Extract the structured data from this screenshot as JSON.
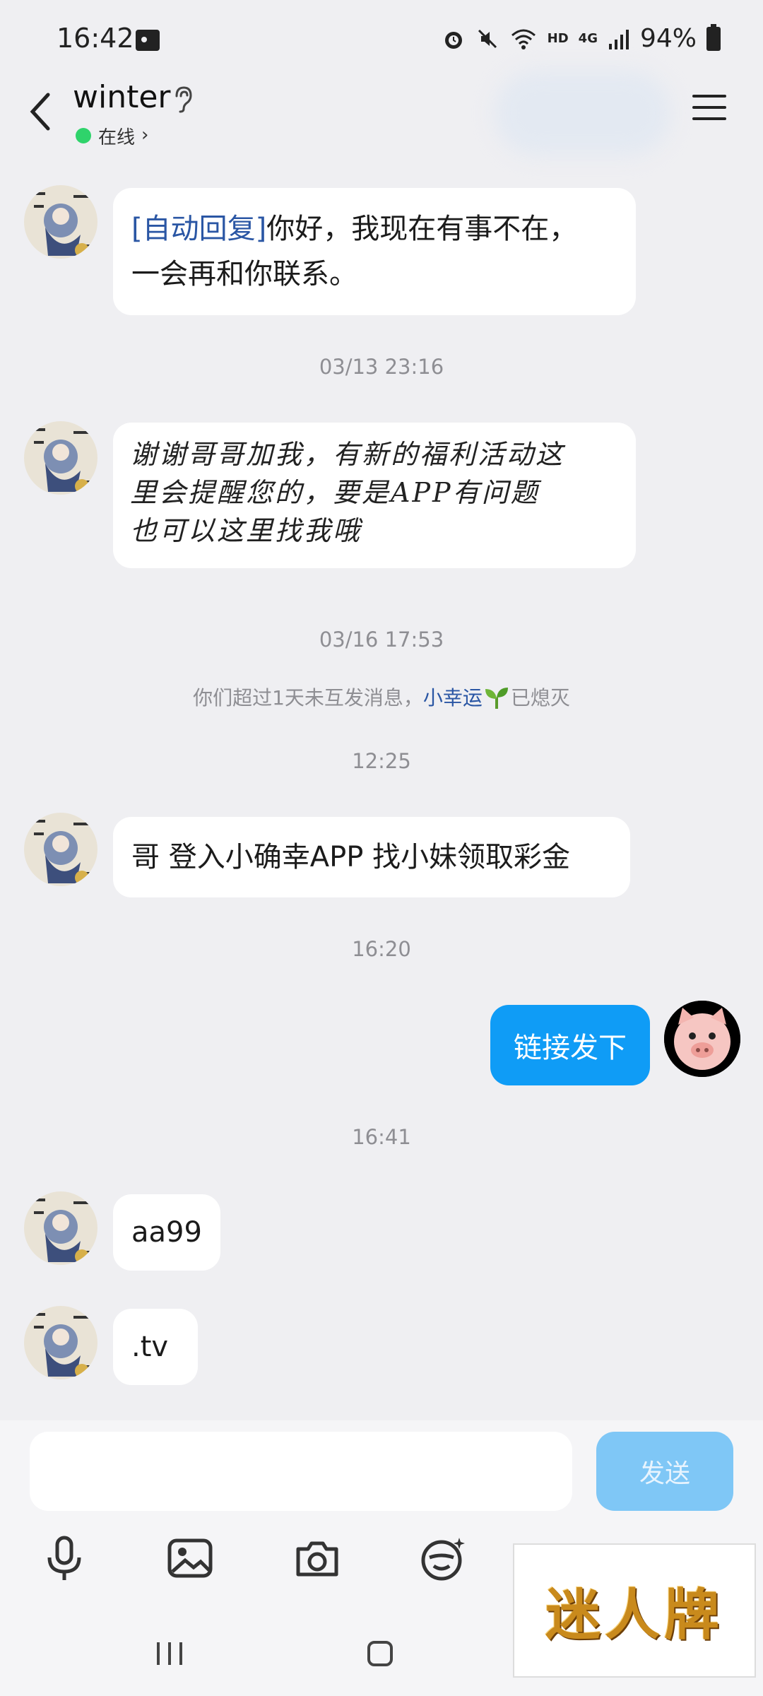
{
  "status_bar": {
    "time": "16:42",
    "hd_label": "HD",
    "network_label": "4G",
    "battery": "94%"
  },
  "header": {
    "contact_name": "winter",
    "status": "在线"
  },
  "messages": {
    "m1_tag": "[自动回复]",
    "m1_text_a": "你好，我现在有事不在，",
    "m1_text_b": "一会再和你联系。",
    "ts1": "03/13 23:16",
    "m2_line1": "谢谢哥哥加我，有新的福利活动这",
    "m2_line2": "里会提醒您的，要是APP有问题",
    "m2_line3": "也可以这里找我哦",
    "ts2": "03/16 17:53",
    "sys_prefix": "你们超过1天未互发消息，",
    "sys_link": "小幸运",
    "sys_suffix": "已熄灭",
    "ts3": "12:25",
    "m3_text": "哥 登入小确幸APP 找小妹领取彩金",
    "ts4": "16:20",
    "me_text": "链接发下",
    "ts5": "16:41",
    "m4_text": "aa99",
    "m5_text": ".tv"
  },
  "composer": {
    "send_label": "发送"
  },
  "watermark": {
    "text": "迷人牌"
  },
  "colors": {
    "accent": "#0f9cf6",
    "send_disabled": "#7fc7f6",
    "online": "#2fd36b",
    "background": "#efeff2"
  }
}
